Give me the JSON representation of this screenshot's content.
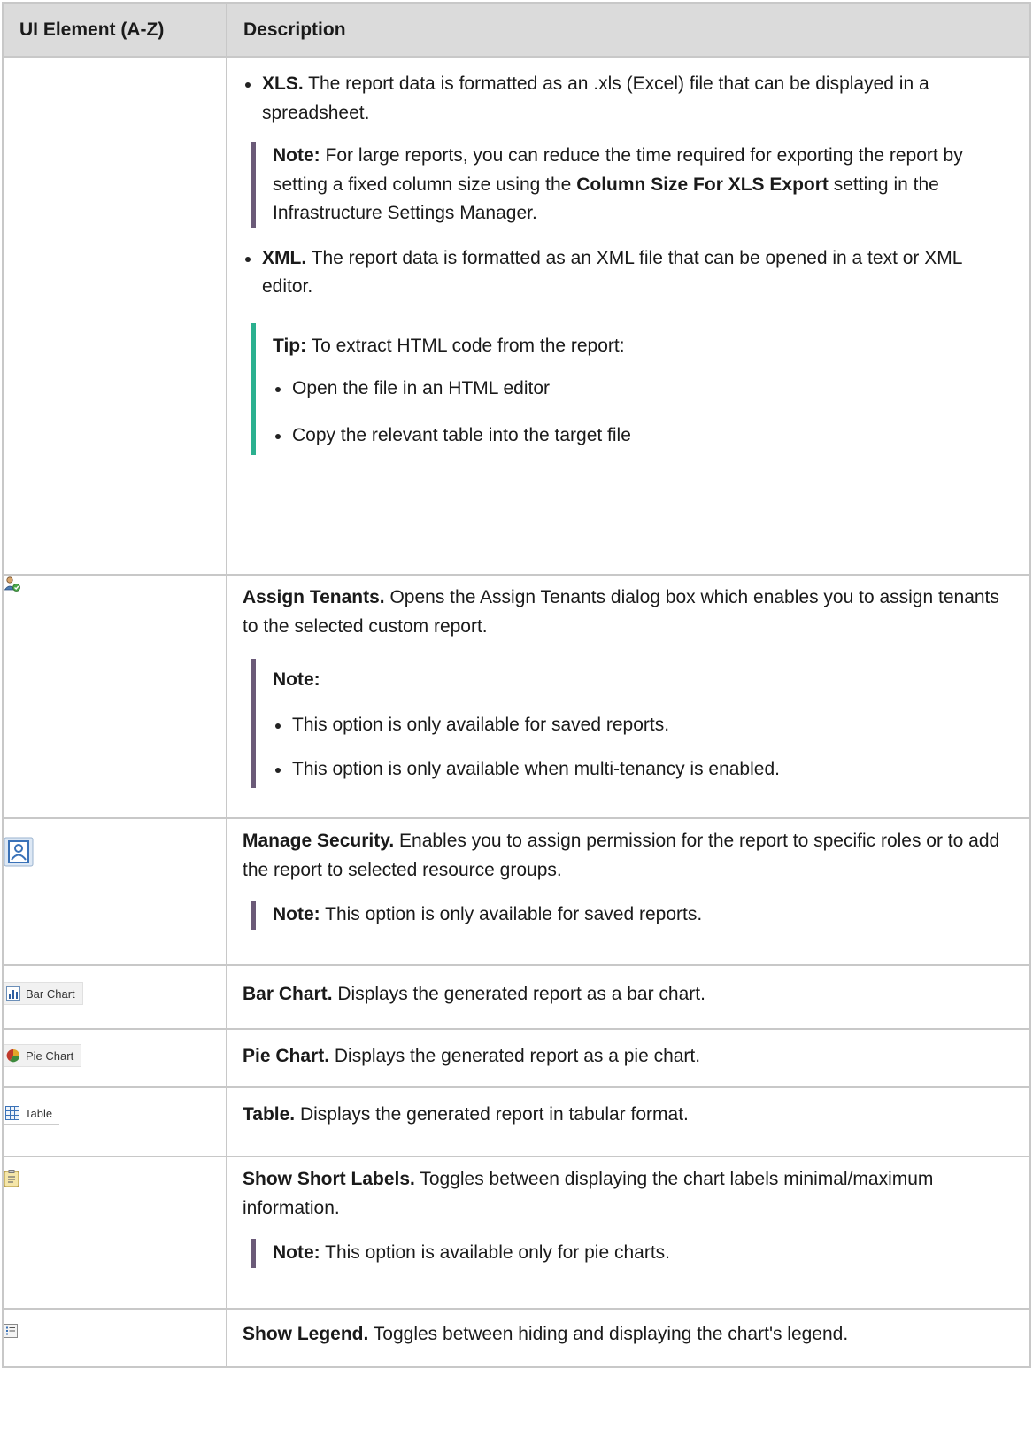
{
  "header": {
    "col1": "UI Element (A-Z)",
    "col2": "Description"
  },
  "row_export": {
    "xls_label": "XLS.",
    "xls_text": " The report data is formatted as an .xls (Excel) file that can be displayed in a spreadsheet.",
    "note_label": "Note:",
    "note_t1": "  For large reports, you can reduce the time required for exporting the report by setting a fixed column size using the ",
    "note_bold": "Column Size For XLS Export",
    "note_t2": " setting in the Infrastructure Settings Manager.",
    "xml_label": "XML.",
    "xml_text": " The report data is formatted as an XML file that can be opened in a text or XML editor.",
    "tip_label": "Tip:",
    "tip_text": "  To extract HTML code from the report:",
    "tip_items": [
      "Open the file in an HTML editor",
      "Copy the relevant table into the target file"
    ]
  },
  "row_assign": {
    "icon": "assign-tenants-icon",
    "title": "Assign Tenants.",
    "text": " Opens the Assign Tenants dialog box which enables you to assign tenants to the selected custom report.",
    "note_label": "Note:",
    "note_items": [
      "This option is only available for saved reports.",
      "This option is only available when multi-tenancy is enabled."
    ]
  },
  "row_security": {
    "icon": "manage-security-icon",
    "title": "Manage Security.",
    "text": " Enables you to assign permission for the report to specific roles or to add the report to selected resource groups.",
    "note_label": "Note:",
    "note_text": "  This option is only available for saved reports."
  },
  "row_bar": {
    "button_label": "Bar Chart",
    "title": "Bar Chart.",
    "text": " Displays the generated report as a bar chart."
  },
  "row_pie": {
    "button_label": "Pie Chart",
    "title": "Pie Chart.",
    "text": " Displays the generated report as a pie chart."
  },
  "row_table": {
    "button_label": "Table",
    "title": "Table.",
    "text": " Displays the generated report in tabular format."
  },
  "row_short": {
    "icon": "short-labels-icon",
    "title": "Show Short Labels.",
    "text": " Toggles between displaying the chart labels minimal/maximum information.",
    "note_label": "Note:",
    "note_text": "  This option is available only for pie charts."
  },
  "row_legend": {
    "icon": "legend-icon",
    "title": "Show Legend.",
    "text": " Toggles between hiding and displaying the chart's legend."
  },
  "colors": {
    "note_bar": "#6b5a78",
    "tip_bar": "#2bb08f",
    "header_bg": "#dbdbdb",
    "border": "#c8c8c8"
  }
}
